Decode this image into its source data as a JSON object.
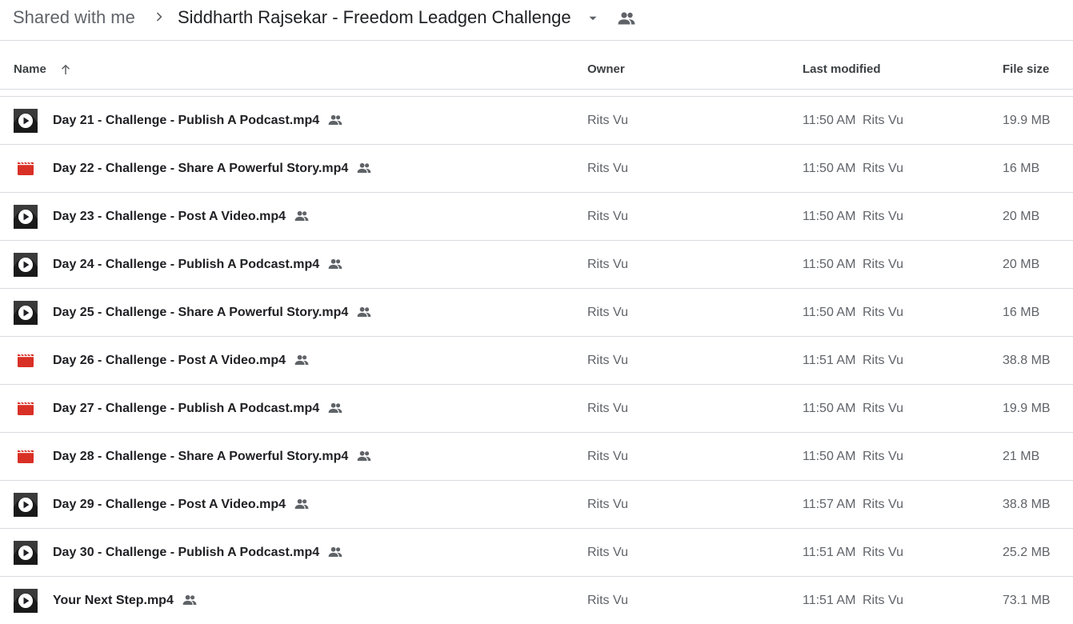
{
  "breadcrumb": {
    "root": "Shared with me",
    "current": "Siddharth Rajsekar - Freedom Leadgen Challenge"
  },
  "columns": {
    "name": "Name",
    "owner": "Owner",
    "last_modified": "Last modified",
    "file_size": "File size"
  },
  "colors": {
    "video_icon_red": "#d93025",
    "divider": "#dadce0",
    "secondary_text": "#5f6368"
  },
  "files": [
    {
      "name": "Day 21 - Challenge - Publish A Podcast.mp4",
      "icon": "video-thumbnail-icon",
      "owner": "Rits Vu",
      "modified_time": "11:50 AM",
      "modified_by": "Rits Vu",
      "size": "19.9 MB"
    },
    {
      "name": "Day 22 - Challenge - Share A Powerful Story.mp4",
      "icon": "video-file-icon",
      "owner": "Rits Vu",
      "modified_time": "11:50 AM",
      "modified_by": "Rits Vu",
      "size": "16 MB"
    },
    {
      "name": "Day 23 - Challenge - Post A Video.mp4",
      "icon": "video-thumbnail-icon",
      "owner": "Rits Vu",
      "modified_time": "11:50 AM",
      "modified_by": "Rits Vu",
      "size": "20 MB"
    },
    {
      "name": "Day 24 - Challenge - Publish A Podcast.mp4",
      "icon": "video-thumbnail-icon",
      "owner": "Rits Vu",
      "modified_time": "11:50 AM",
      "modified_by": "Rits Vu",
      "size": "20 MB"
    },
    {
      "name": "Day 25 - Challenge - Share A Powerful Story.mp4",
      "icon": "video-thumbnail-icon",
      "owner": "Rits Vu",
      "modified_time": "11:50 AM",
      "modified_by": "Rits Vu",
      "size": "16 MB"
    },
    {
      "name": "Day 26 - Challenge - Post A Video.mp4",
      "icon": "video-file-icon",
      "owner": "Rits Vu",
      "modified_time": "11:51 AM",
      "modified_by": "Rits Vu",
      "size": "38.8 MB"
    },
    {
      "name": "Day 27 - Challenge - Publish A Podcast.mp4",
      "icon": "video-file-icon",
      "owner": "Rits Vu",
      "modified_time": "11:50 AM",
      "modified_by": "Rits Vu",
      "size": "19.9 MB"
    },
    {
      "name": "Day 28 - Challenge - Share A Powerful Story.mp4",
      "icon": "video-file-icon",
      "owner": "Rits Vu",
      "modified_time": "11:50 AM",
      "modified_by": "Rits Vu",
      "size": "21 MB"
    },
    {
      "name": "Day 29 - Challenge - Post A Video.mp4",
      "icon": "video-thumbnail-icon",
      "owner": "Rits Vu",
      "modified_time": "11:57 AM",
      "modified_by": "Rits Vu",
      "size": "38.8 MB"
    },
    {
      "name": "Day 30 - Challenge - Publish A Podcast.mp4",
      "icon": "video-thumbnail-icon",
      "owner": "Rits Vu",
      "modified_time": "11:51 AM",
      "modified_by": "Rits Vu",
      "size": "25.2 MB"
    },
    {
      "name": "Your Next Step.mp4",
      "icon": "video-thumbnail-icon",
      "owner": "Rits Vu",
      "modified_time": "11:51 AM",
      "modified_by": "Rits Vu",
      "size": "73.1 MB"
    }
  ]
}
